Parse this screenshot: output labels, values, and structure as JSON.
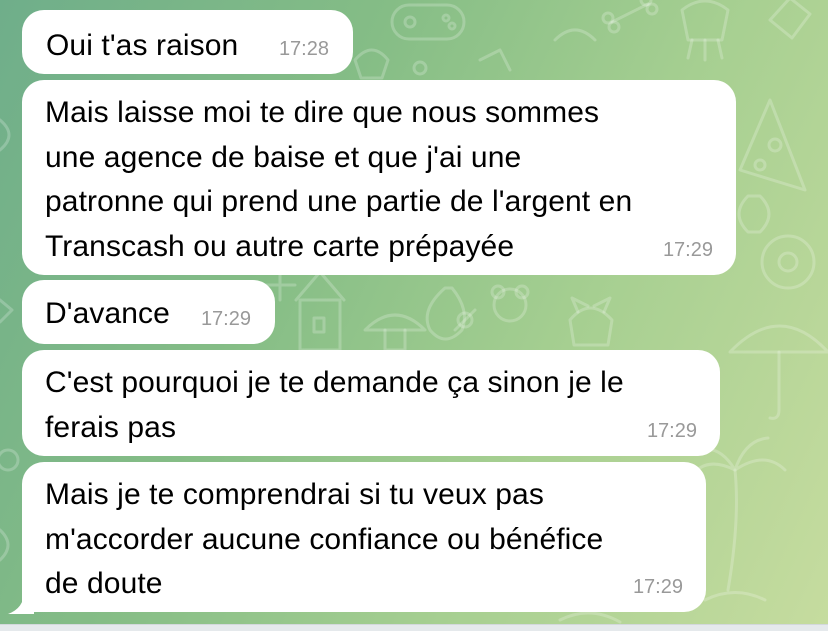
{
  "messages": [
    {
      "text": "Oui t'as raison",
      "time": "17:28"
    },
    {
      "text": "Mais laisse moi te dire que nous sommes\nune agence de baise et que j'ai une\npatronne qui prend une partie de l'argent en\nTranscash ou autre carte prépayée",
      "time": "17:29"
    },
    {
      "text": "D'avance",
      "time": "17:29"
    },
    {
      "text": "C'est pourquoi je te demande ça sinon je le\nferais pas",
      "time": "17:29"
    },
    {
      "text": "Mais je te comprendrai si tu veux pas\nm'accorder aucune confiance ou bénéfice\nde doute",
      "time": "17:29"
    }
  ],
  "theme": {
    "bubble_color": "#ffffff",
    "time_color": "#999999",
    "wallpaper_start": "#6fae8a",
    "wallpaper_end": "#c6dc9f"
  }
}
